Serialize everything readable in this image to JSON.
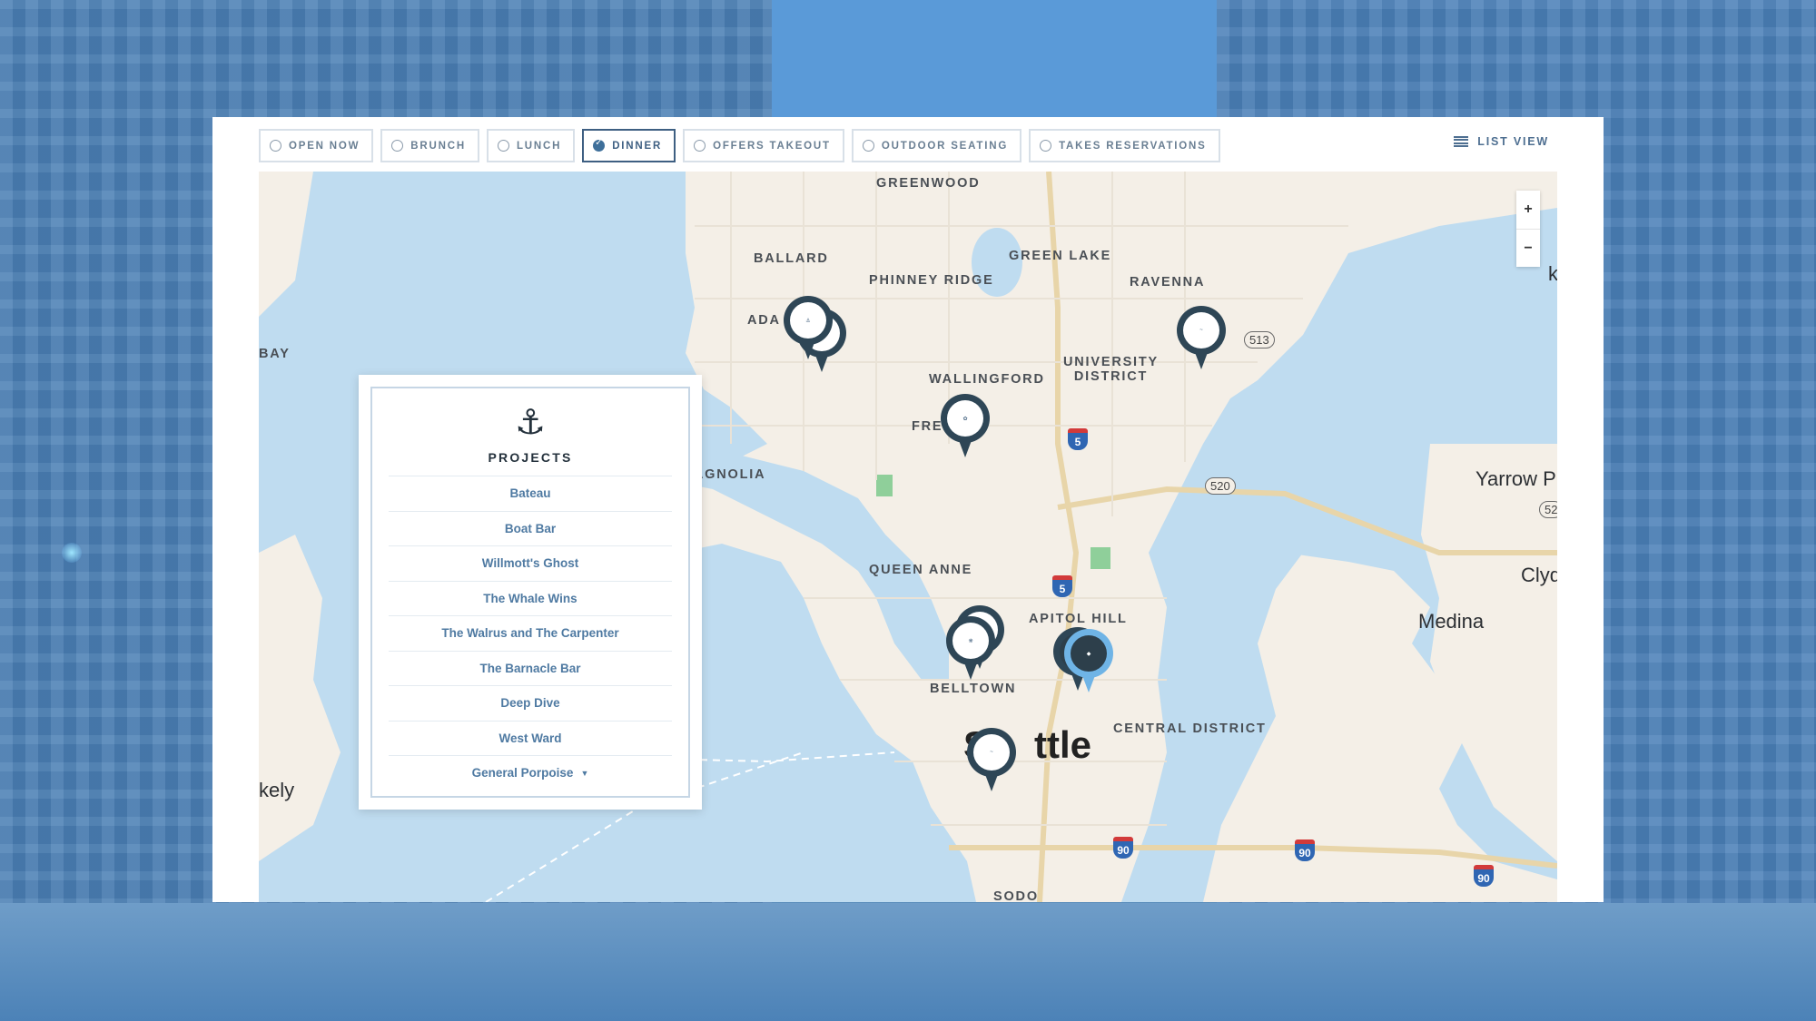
{
  "filters": [
    {
      "label": "OPEN NOW",
      "checked": false
    },
    {
      "label": "BRUNCH",
      "checked": false
    },
    {
      "label": "LUNCH",
      "checked": false
    },
    {
      "label": "DINNER",
      "checked": true
    },
    {
      "label": "OFFERS TAKEOUT",
      "checked": false
    },
    {
      "label": "OUTDOOR SEATING",
      "checked": false
    },
    {
      "label": "TAKES RESERVATIONS",
      "checked": false
    }
  ],
  "list_view_label": "LIST VIEW",
  "zoom": {
    "in": "+",
    "out": "−"
  },
  "map_labels": {
    "greenwood": "GREENWOOD",
    "ballard": "BALLARD",
    "phinney_ridge": "PHINNEY RIDGE",
    "green_lake": "GREEN LAKE",
    "ravenna": "RAVENNA",
    "adams": "ADA",
    "university_district": "UNIVERSITY\nDISTRICT",
    "wallingford": "WALLINGFORD",
    "fremont": "FREMON",
    "magnolia": "MAGNOLIA",
    "bay": "BAY",
    "queen_anne": "QUEEN ANNE",
    "capitol_hill": "APITOL HILL",
    "belltown": "BELLTOWN",
    "central_district": "CENTRAL DISTRICT",
    "seattle_left": "S",
    "seattle_right": "ttle",
    "sodo": "SODO",
    "yarrow": "Yarrow P",
    "clyde": "Clyde H",
    "medina": "Medina",
    "berkeley": "kely",
    "k": "k"
  },
  "shields": {
    "i5_north": "5",
    "i5_south": "5",
    "i90_a": "90",
    "i90_b": "90",
    "i90_c": "90"
  },
  "routes": {
    "r513": "513",
    "r520": "520",
    "r52": "52"
  },
  "projects_panel": {
    "title": "PROJECTS",
    "items": [
      "Bateau",
      "Boat Bar",
      "Willmott's Ghost",
      "The Whale Wins",
      "The Walrus and The Carpenter",
      "The Barnacle Bar",
      "Deep Dive",
      "West Ward",
      "General Porpoise"
    ]
  }
}
